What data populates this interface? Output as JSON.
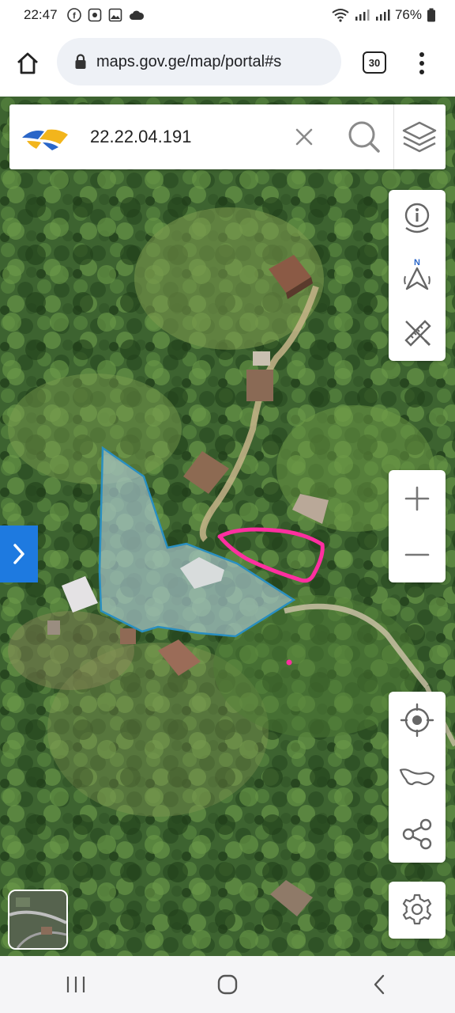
{
  "status_bar": {
    "time": "22:47",
    "battery": "76%",
    "notification_icons": [
      "facebook-icon",
      "messenger-icon",
      "gallery-icon",
      "cloud-icon"
    ]
  },
  "browser": {
    "url": "maps.gov.ge/map/portal#s",
    "tab_count": "30"
  },
  "search": {
    "value": "22.22.04.191"
  },
  "colors": {
    "accent": "#1e7ae0",
    "parcel_fill": "#a9c7cf",
    "parcel_stroke": "#2a8fc0",
    "annotation": "#ff2fa0",
    "icon": "#666666"
  },
  "icons": {
    "top_panel": [
      "info-icon",
      "north-arrow-icon",
      "measure-icon"
    ],
    "zoom_panel": [
      "zoom-in-icon",
      "zoom-out-icon"
    ],
    "tools_panel": [
      "locate-icon",
      "country-extent-icon",
      "share-icon"
    ],
    "settings_panel": [
      "settings-icon"
    ]
  },
  "north_label": "N"
}
